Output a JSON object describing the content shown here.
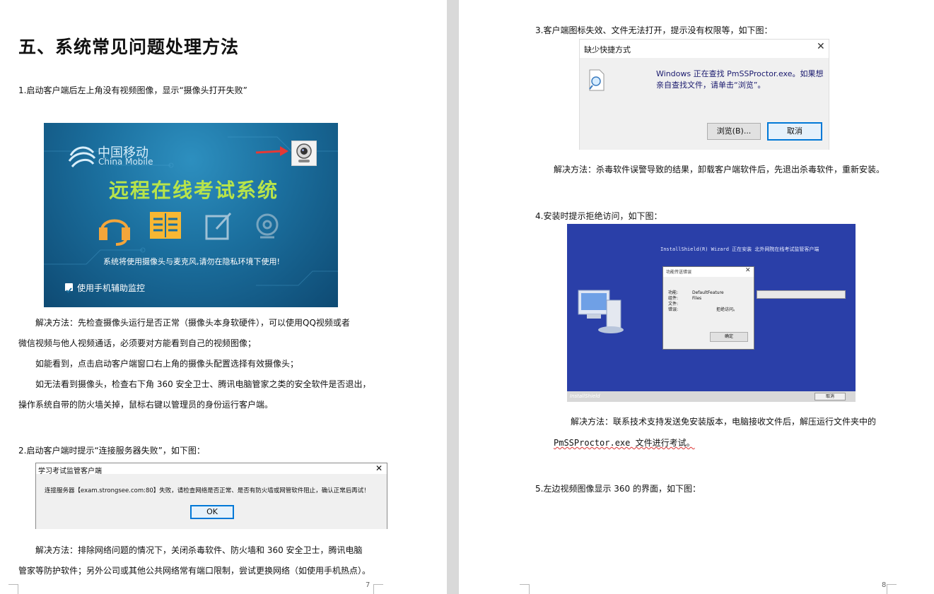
{
  "left_page": {
    "heading": "五、系统常见问题处理方法",
    "item1_title": "1.启动客户端后左上角没有视频图像，显示“摄像头打开失败”",
    "app_screenshot": {
      "logo_cn": "中国移动",
      "logo_en": "China Mobile",
      "title": "远程在线考试系统",
      "notice": "系统将使用摄像头与麦克风,请勿在隐私环境下使用!",
      "checkbox_label": "使用手机辅助监控"
    },
    "item1_solution_lines": [
      "解决方法：先检查摄像头运行是否正常（摄像头本身软硬件），可以使用QQ视频或者",
      "微信视频与他人视频通话，必须要对方能看到自己的视频图像；",
      "如能看到，点击启动客户端窗口右上角的摄像头配置选择有效摄像头；",
      "如无法看到摄像头，检查右下角 360 安全卫士、腾讯电脑管家之类的安全软件是否退出，",
      "操作系统自带的防火墙关掉，鼠标右键以管理员的身份运行客户端。"
    ],
    "item2_title": "2.启动客户端时提示“连接服务器失败”，如下图：",
    "connect_dialog": {
      "title": "学习考试监管客户端",
      "message": "连接服务器【exam.strongsee.com:80】失败，请检查网络是否正常、是否有防火墙或网管软件阻止，确认正常后再试！",
      "ok_label": "OK",
      "close_glyph": "✕"
    },
    "item2_solution_lines": [
      "解决方法：排除网络问题的情况下，关闭杀毒软件、防火墙和 360 安全卫士，腾讯电脑",
      "管家等防护软件；另外公司或其他公共网络常有端口限制，尝试更换网络（如使用手机热点）。"
    ],
    "page_number": "7"
  },
  "right_page": {
    "item3_title": "3.客户端图标失效、文件无法打开，提示没有权限等，如下图：",
    "shortcut_dialog": {
      "title": "缺少快捷方式",
      "message_line1": "Windows 正在查找 PmSSProctor.exe。如果想",
      "message_line2": "亲自查找文件，请单击“浏览”。",
      "browse_label": "浏览(B)...",
      "cancel_label": "取消",
      "close_glyph": "✕"
    },
    "item3_solution": "解决方法：杀毒软件误警导致的结果，卸载客户端软件后，先退出杀毒软件，重新安装。",
    "item4_title": "4.安装时提示拒绝访问，如下图：",
    "install_screenshot": {
      "header": "InstallShield(R) Wizard 正在安装 北外网院在线考试监管客户端",
      "error_title": "功能传送错误",
      "fields": [
        {
          "label": "功能:",
          "value": "DefaultFeature"
        },
        {
          "label": "组件:",
          "value": "Files"
        },
        {
          "label": "文件:",
          "value": ""
        },
        {
          "label": "错误:",
          "value": "拒绝访问。"
        }
      ],
      "ok_label": "确定",
      "cancel_label": "取消",
      "footer_brand": "InstallShield",
      "close_glyph": "✕"
    },
    "item4_solution_line1": "解决方法：联系技术支持发送免安装版本，电脑接收文件后，解压运行文件夹中的",
    "item4_solution_line2": "PmSSProctor.exe 文件进行考试。",
    "item5_title": "5.左边视频图像显示 360 的界面，如下图：",
    "page_number": "8"
  },
  "colors": {
    "gutter": "#d9d9d9",
    "app_title": "#b8e44a",
    "arrow": "#e53935",
    "install_bg": "#2a3fa8",
    "dialog_focus": "#0078d7"
  }
}
